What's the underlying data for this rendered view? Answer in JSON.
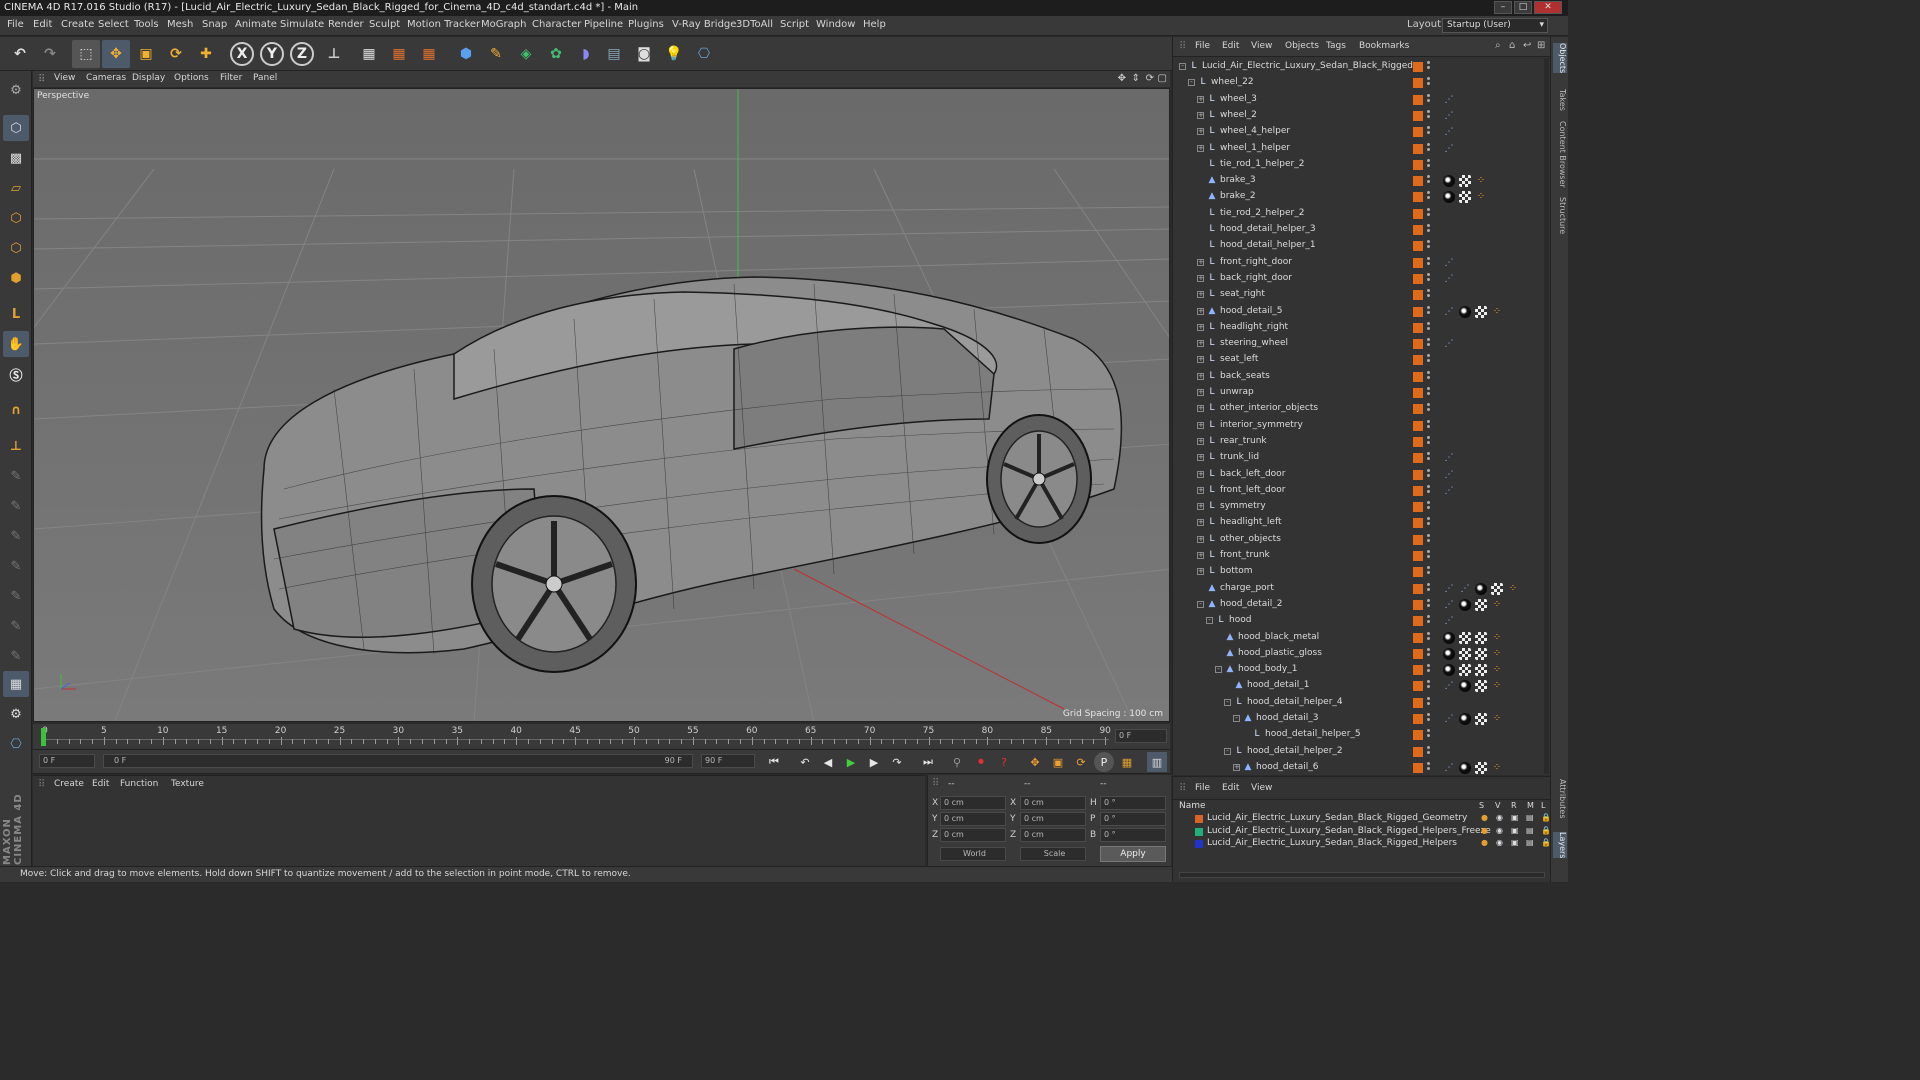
{
  "window": {
    "title": "CINEMA 4D R17.016 Studio (R17) - [Lucid_Air_Electric_Luxury_Sedan_Black_Rigged_for_Cinema_4D_c4d_standart.c4d *] - Main"
  },
  "menubar": {
    "items": [
      "File",
      "Edit",
      "Create",
      "Select",
      "Tools",
      "Mesh",
      "Snap",
      "Animate",
      "Simulate",
      "Render",
      "Sculpt",
      "Motion Tracker",
      "MoGraph",
      "Character",
      "Pipeline",
      "Plugins",
      "V-Ray Bridge",
      "3DToAll",
      "Script",
      "Window",
      "Help"
    ],
    "layout_label": "Layout:",
    "layout_value": "Startup (User)"
  },
  "toolbar": {
    "axis_x": "X",
    "axis_y": "Y",
    "axis_z": "Z"
  },
  "viewport": {
    "menu": [
      "View",
      "Cameras",
      "Display",
      "Options",
      "Filter",
      "Panel"
    ],
    "camera_label": "Perspective",
    "grid_spacing": "Grid Spacing : 100 cm"
  },
  "timeline": {
    "ticks": [
      "0",
      "5",
      "10",
      "15",
      "20",
      "25",
      "30",
      "35",
      "40",
      "45",
      "50",
      "55",
      "60",
      "65",
      "70",
      "75",
      "80",
      "85",
      "90"
    ],
    "end_frame_field": "0 F",
    "current_field": "0 F",
    "range_start": "0 F",
    "range_end": "90 F",
    "max_field": "90 F"
  },
  "material_panel": {
    "menu": [
      "Create",
      "Edit",
      "Function",
      "Texture"
    ]
  },
  "attributes": {
    "header": [
      "--",
      "--",
      "--"
    ],
    "rows": [
      {
        "l1": "X",
        "v1": "0 cm",
        "l2": "X",
        "v2": "0 cm",
        "l3": "H",
        "v3": "0 °"
      },
      {
        "l1": "Y",
        "v1": "0 cm",
        "l2": "Y",
        "v2": "0 cm",
        "l3": "P",
        "v3": "0 °"
      },
      {
        "l1": "Z",
        "v1": "0 cm",
        "l2": "Z",
        "v2": "0 cm",
        "l3": "B",
        "v3": "0 °"
      }
    ],
    "coord_system": "World",
    "mode": "Scale",
    "apply": "Apply"
  },
  "statusbar": {
    "text": "Move: Click and drag to move elements. Hold down SHIFT to quantize movement / add to the selection in point mode, CTRL to remove."
  },
  "objects_panel": {
    "menu": [
      "File",
      "Edit",
      "View",
      "Objects",
      "Tags",
      "Bookmarks"
    ],
    "tree": [
      {
        "name": "Lucid_Air_Electric_Luxury_Sedan_Black_Rigged",
        "depth": 0,
        "type": "null",
        "exp": "-",
        "tags": []
      },
      {
        "name": "wheel_22",
        "depth": 1,
        "type": "null",
        "exp": "-",
        "tags": []
      },
      {
        "name": "wheel_3",
        "depth": 2,
        "type": "null",
        "exp": "+",
        "tags": [
          "ik"
        ]
      },
      {
        "name": "wheel_2",
        "depth": 2,
        "type": "null",
        "exp": "+",
        "tags": [
          "ik"
        ]
      },
      {
        "name": "wheel_4_helper",
        "depth": 2,
        "type": "null",
        "exp": "+",
        "tags": [
          "ik"
        ]
      },
      {
        "name": "wheel_1_helper",
        "depth": 2,
        "type": "null",
        "exp": "+",
        "tags": [
          "ik"
        ]
      },
      {
        "name": "tie_rod_1_helper_2",
        "depth": 2,
        "type": "null",
        "exp": "",
        "tags": []
      },
      {
        "name": "brake_3",
        "depth": 2,
        "type": "poly",
        "exp": "",
        "tags": [
          "mat",
          "check",
          "dot"
        ]
      },
      {
        "name": "brake_2",
        "depth": 2,
        "type": "poly",
        "exp": "",
        "tags": [
          "mat",
          "check",
          "dot"
        ]
      },
      {
        "name": "tie_rod_2_helper_2",
        "depth": 2,
        "type": "null",
        "exp": "",
        "tags": []
      },
      {
        "name": "hood_detail_helper_3",
        "depth": 2,
        "type": "null",
        "exp": "",
        "tags": []
      },
      {
        "name": "hood_detail_helper_1",
        "depth": 2,
        "type": "null",
        "exp": "",
        "tags": []
      },
      {
        "name": "front_right_door",
        "depth": 2,
        "type": "null",
        "exp": "+",
        "tags": [
          "ik"
        ]
      },
      {
        "name": "back_right_door",
        "depth": 2,
        "type": "null",
        "exp": "+",
        "tags": [
          "ik"
        ]
      },
      {
        "name": "seat_right",
        "depth": 2,
        "type": "null",
        "exp": "+",
        "tags": []
      },
      {
        "name": "hood_detail_5",
        "depth": 2,
        "type": "poly",
        "exp": "+",
        "tags": [
          "ik",
          "mat",
          "check",
          "dot"
        ]
      },
      {
        "name": "headlight_right",
        "depth": 2,
        "type": "null",
        "exp": "+",
        "tags": []
      },
      {
        "name": "steering_wheel",
        "depth": 2,
        "type": "null",
        "exp": "+",
        "tags": [
          "ik"
        ]
      },
      {
        "name": "seat_left",
        "depth": 2,
        "type": "null",
        "exp": "+",
        "tags": []
      },
      {
        "name": "back_seats",
        "depth": 2,
        "type": "null",
        "exp": "+",
        "tags": []
      },
      {
        "name": "unwrap",
        "depth": 2,
        "type": "null",
        "exp": "+",
        "tags": []
      },
      {
        "name": "other_interior_objects",
        "depth": 2,
        "type": "null",
        "exp": "+",
        "tags": []
      },
      {
        "name": "interior_symmetry",
        "depth": 2,
        "type": "null",
        "exp": "+",
        "tags": []
      },
      {
        "name": "rear_trunk",
        "depth": 2,
        "type": "null",
        "exp": "+",
        "tags": []
      },
      {
        "name": "trunk_lid",
        "depth": 2,
        "type": "null",
        "exp": "+",
        "tags": [
          "ik"
        ]
      },
      {
        "name": "back_left_door",
        "depth": 2,
        "type": "null",
        "exp": "+",
        "tags": [
          "ik"
        ]
      },
      {
        "name": "front_left_door",
        "depth": 2,
        "type": "null",
        "exp": "+",
        "tags": [
          "ik"
        ]
      },
      {
        "name": "symmetry",
        "depth": 2,
        "type": "null",
        "exp": "+",
        "tags": []
      },
      {
        "name": "headlight_left",
        "depth": 2,
        "type": "null",
        "exp": "+",
        "tags": []
      },
      {
        "name": "other_objects",
        "depth": 2,
        "type": "null",
        "exp": "+",
        "tags": []
      },
      {
        "name": "front_trunk",
        "depth": 2,
        "type": "null",
        "exp": "+",
        "tags": []
      },
      {
        "name": "bottom",
        "depth": 2,
        "type": "null",
        "exp": "+",
        "tags": []
      },
      {
        "name": "charge_port",
        "depth": 2,
        "type": "poly",
        "exp": "",
        "tags": [
          "ik",
          "ik",
          "mat",
          "check",
          "dot"
        ]
      },
      {
        "name": "hood_detail_2",
        "depth": 2,
        "type": "poly",
        "exp": "-",
        "tags": [
          "ik",
          "mat",
          "check",
          "dot"
        ]
      },
      {
        "name": "hood",
        "depth": 3,
        "type": "null",
        "exp": "-",
        "tags": [
          "ik"
        ]
      },
      {
        "name": "hood_black_metal",
        "depth": 4,
        "type": "poly",
        "exp": "",
        "tags": [
          "mat",
          "check",
          "check",
          "dot"
        ]
      },
      {
        "name": "hood_plastic_gloss",
        "depth": 4,
        "type": "poly",
        "exp": "",
        "tags": [
          "mat",
          "check",
          "check",
          "dot"
        ]
      },
      {
        "name": "hood_body_1",
        "depth": 4,
        "type": "poly",
        "exp": "-",
        "tags": [
          "mat",
          "check",
          "check",
          "dot"
        ]
      },
      {
        "name": "hood_detail_1",
        "depth": 5,
        "type": "poly",
        "exp": "",
        "tags": [
          "ik",
          "mat",
          "check",
          "dot"
        ]
      },
      {
        "name": "hood_detail_helper_4",
        "depth": 5,
        "type": "null",
        "exp": "-",
        "tags": []
      },
      {
        "name": "hood_detail_3",
        "depth": 6,
        "type": "poly",
        "exp": "-",
        "tags": [
          "ik",
          "mat",
          "check",
          "dot"
        ]
      },
      {
        "name": "hood_detail_helper_5",
        "depth": 7,
        "type": "null",
        "exp": "",
        "tags": []
      },
      {
        "name": "hood_detail_helper_2",
        "depth": 5,
        "type": "null",
        "exp": "-",
        "tags": []
      },
      {
        "name": "hood_detail_6",
        "depth": 6,
        "type": "poly",
        "exp": "+",
        "tags": [
          "ik",
          "mat",
          "check",
          "dot"
        ]
      }
    ]
  },
  "layers_panel": {
    "menu": [
      "File",
      "Edit",
      "View"
    ],
    "name_header": "Name",
    "col_headers": [
      "S",
      "V",
      "R",
      "M",
      "L"
    ],
    "layers": [
      {
        "name": "Lucid_Air_Electric_Luxury_Sedan_Black_Rigged_Geometry",
        "color": "#d9642a"
      },
      {
        "name": "Lucid_Air_Electric_Luxury_Sedan_Black_Rigged_Helpers_Freeze",
        "color": "#22b07a"
      },
      {
        "name": "Lucid_Air_Electric_Luxury_Sedan_Black_Rigged_Helpers",
        "color": "#2233cc"
      }
    ]
  },
  "right_tabs": [
    "Objects",
    "Takes",
    "Content Browser",
    "Structure"
  ],
  "right_tabs_bottom": [
    "Attributes",
    "Layers"
  ],
  "brand": "MAXON CINEMA 4D"
}
